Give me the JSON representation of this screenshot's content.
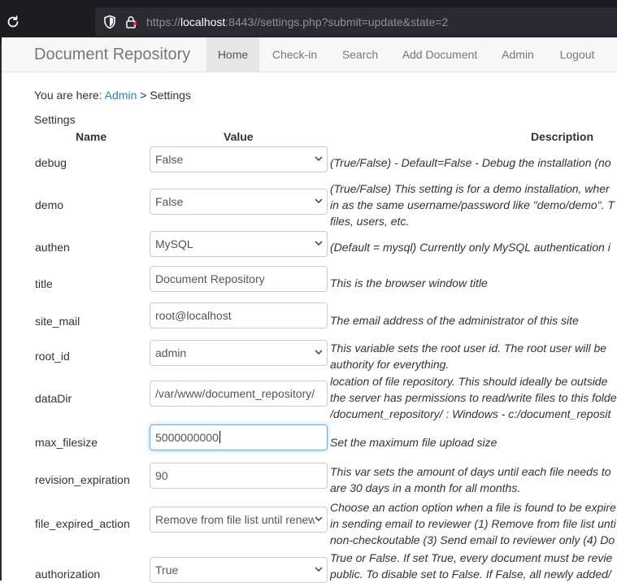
{
  "browser": {
    "url_prefix": "https://",
    "url_host": "localhost",
    "url_rest": ":8443//settings.php?submit=update&state=2"
  },
  "navbar": {
    "brand": "Document Repository",
    "items": [
      {
        "label": "Home",
        "active": true
      },
      {
        "label": "Check-in",
        "active": false
      },
      {
        "label": "Search",
        "active": false
      },
      {
        "label": "Add Document",
        "active": false
      },
      {
        "label": "Admin",
        "active": false
      },
      {
        "label": "Logout",
        "active": false
      }
    ]
  },
  "breadcrumb": {
    "prefix": "You are here: ",
    "link": "Admin",
    "separator": " > ",
    "current": "Settings"
  },
  "settings": {
    "heading": "Settings",
    "columns": {
      "name": "Name",
      "value": "Value",
      "description": "Description"
    },
    "rows": [
      {
        "name": "debug",
        "type": "select",
        "value": "False",
        "desc": [
          "(True/False) - Default=False - Debug the installation (no"
        ]
      },
      {
        "name": "demo",
        "type": "select",
        "value": "False",
        "desc": [
          "(True/False) This setting is for a demo installation, wher",
          "in as the same username/password like \"demo/demo\". T",
          "files, users, etc."
        ]
      },
      {
        "name": "authen",
        "type": "select",
        "value": "MySQL",
        "desc": [
          "(Default = mysql) Currently only MySQL authentication i"
        ]
      },
      {
        "name": "title",
        "type": "text",
        "value": "Document Repository",
        "desc": [
          "This is the browser window title"
        ]
      },
      {
        "name": "site_mail",
        "type": "text",
        "value": "root@localhost",
        "desc": [
          "The email address of the administrator of this site"
        ]
      },
      {
        "name": "root_id",
        "type": "select",
        "value": "admin",
        "desc": [
          "This variable sets the root user id. The root user will be",
          "authority for everything."
        ]
      },
      {
        "name": "dataDir",
        "type": "text",
        "value": "/var/www/document_repository/",
        "desc": [
          "location of file repository. This should ideally be outside",
          "the server has permissions to read/write files to this folde",
          "/document_repository/ : Windows - c:/document_reposit"
        ]
      },
      {
        "name": "max_filesize",
        "type": "text",
        "value": "5000000000",
        "focused": true,
        "desc": [
          "Set the maximum file upload size"
        ]
      },
      {
        "name": "revision_expiration",
        "type": "text",
        "value": "90",
        "desc": [
          "This var sets the amount of days until each file needs to",
          "are 30 days in a month for all months."
        ]
      },
      {
        "name": "file_expired_action",
        "type": "select",
        "value": "Remove from file list until renew",
        "desc": [
          "Choose an action option when a file is found to be expire",
          "in sending email to reviewer (1) Remove from file list unti",
          "non-checkoutable (3) Send email to reviewer only (4) Do"
        ]
      },
      {
        "name": "authorization",
        "type": "select",
        "value": "True",
        "desc": [
          "True or False. If set True, every document must be revie",
          "public. To disable set to False. If False, all newly added/"
        ]
      }
    ]
  },
  "colors": {
    "link": "#337ab7",
    "focus": "#66afe9",
    "chrome_bg": "#1c1b22"
  },
  "icons": [
    "reload-icon",
    "shield-icon",
    "lock-icon",
    "chevron-down-icon"
  ]
}
